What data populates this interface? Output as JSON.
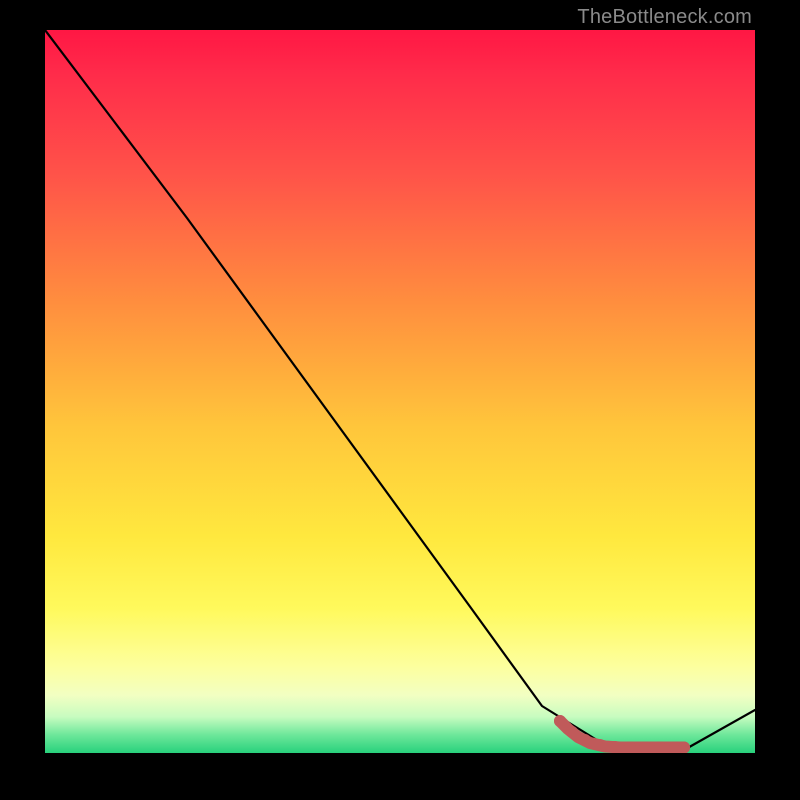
{
  "watermark": "TheBottleneck.com",
  "chart_data": {
    "type": "line",
    "title": "",
    "xlabel": "",
    "ylabel": "",
    "x": [
      0,
      1,
      2,
      3,
      4,
      5,
      6,
      7,
      8,
      9,
      10
    ],
    "series": [
      {
        "name": "black-line",
        "values_pct_of_height": [
          100,
          87,
          74,
          60.5,
          47,
          33.5,
          20,
          6.5,
          0.2,
          0.2,
          6
        ]
      }
    ],
    "highlight_segment": {
      "name": "optimal-range",
      "x_range": [
        7.25,
        9.0
      ],
      "y_pct": 0.8,
      "color": "#c05a5a"
    },
    "ylim_pct": [
      0,
      100
    ],
    "xlim": [
      0,
      10
    ],
    "note": "No visible axes, ticks, or numeric labels. Values are percentages of plot height read from pixel positions."
  }
}
